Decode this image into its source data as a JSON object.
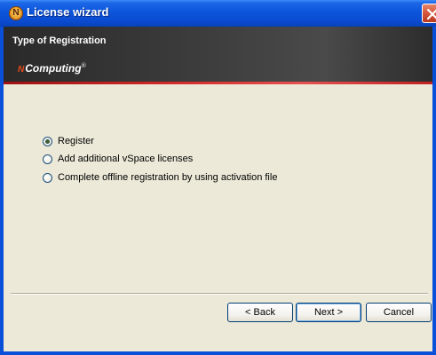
{
  "window": {
    "title": "License wizard",
    "icon": "n-logo-icon"
  },
  "banner": {
    "heading": "Type of Registration",
    "logo_prefix": "N",
    "logo_text": "Computing",
    "logo_mark": "®"
  },
  "options": [
    {
      "label": "Register",
      "checked": true
    },
    {
      "label": "Add additional vSpace licenses",
      "checked": false
    },
    {
      "label": "Complete offline registration by using activation file",
      "checked": false
    }
  ],
  "buttons": {
    "back": "< Back",
    "next": "Next >",
    "cancel": "Cancel"
  },
  "colors": {
    "titlebar": "#0a55da",
    "banner": "#333333",
    "accent_line": "#d42a2a",
    "dialog_bg": "#ece9d8"
  }
}
